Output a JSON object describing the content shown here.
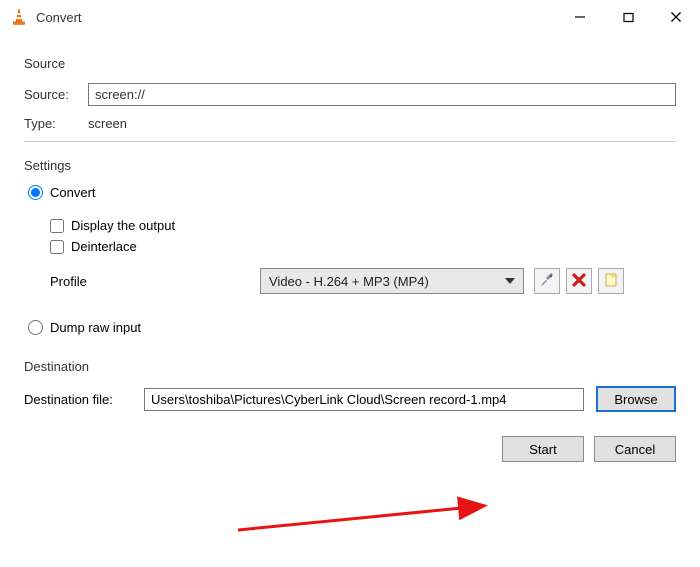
{
  "window": {
    "title": "Convert"
  },
  "source": {
    "section_label": "Source",
    "source_label": "Source:",
    "source_value": "screen://",
    "type_label": "Type:",
    "type_value": "screen"
  },
  "settings": {
    "section_label": "Settings",
    "convert_label": "Convert",
    "display_output_label": "Display the output",
    "deinterlace_label": "Deinterlace",
    "profile_label": "Profile",
    "profile_selected": "Video - H.264 + MP3 (MP4)",
    "dump_raw_label": "Dump raw input"
  },
  "destination": {
    "section_label": "Destination",
    "file_label": "Destination file:",
    "file_value": "Users\\toshiba\\Pictures\\CyberLink Cloud\\Screen record-1.mp4",
    "browse_label": "Browse"
  },
  "footer": {
    "start_label": "Start",
    "cancel_label": "Cancel"
  }
}
